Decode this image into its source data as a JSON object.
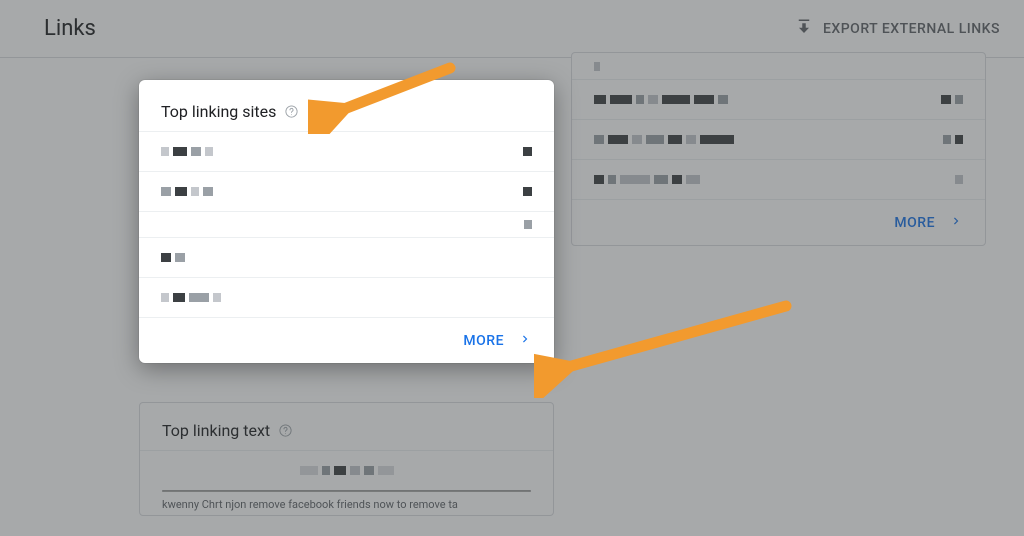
{
  "header": {
    "title": "Links",
    "export_label": "EXPORT EXTERNAL LINKS"
  },
  "spotlight_card": {
    "title": "Top linking sites",
    "more_label": "MORE"
  },
  "right_card": {
    "more_label": "MORE"
  },
  "bottom_card": {
    "title": "Top linking text",
    "tiny_text": "kwenny Chrt njon remove facebook friends now to remove ta"
  },
  "colors": {
    "accent": "#1a73e8",
    "arrow": "#f29a2e"
  }
}
